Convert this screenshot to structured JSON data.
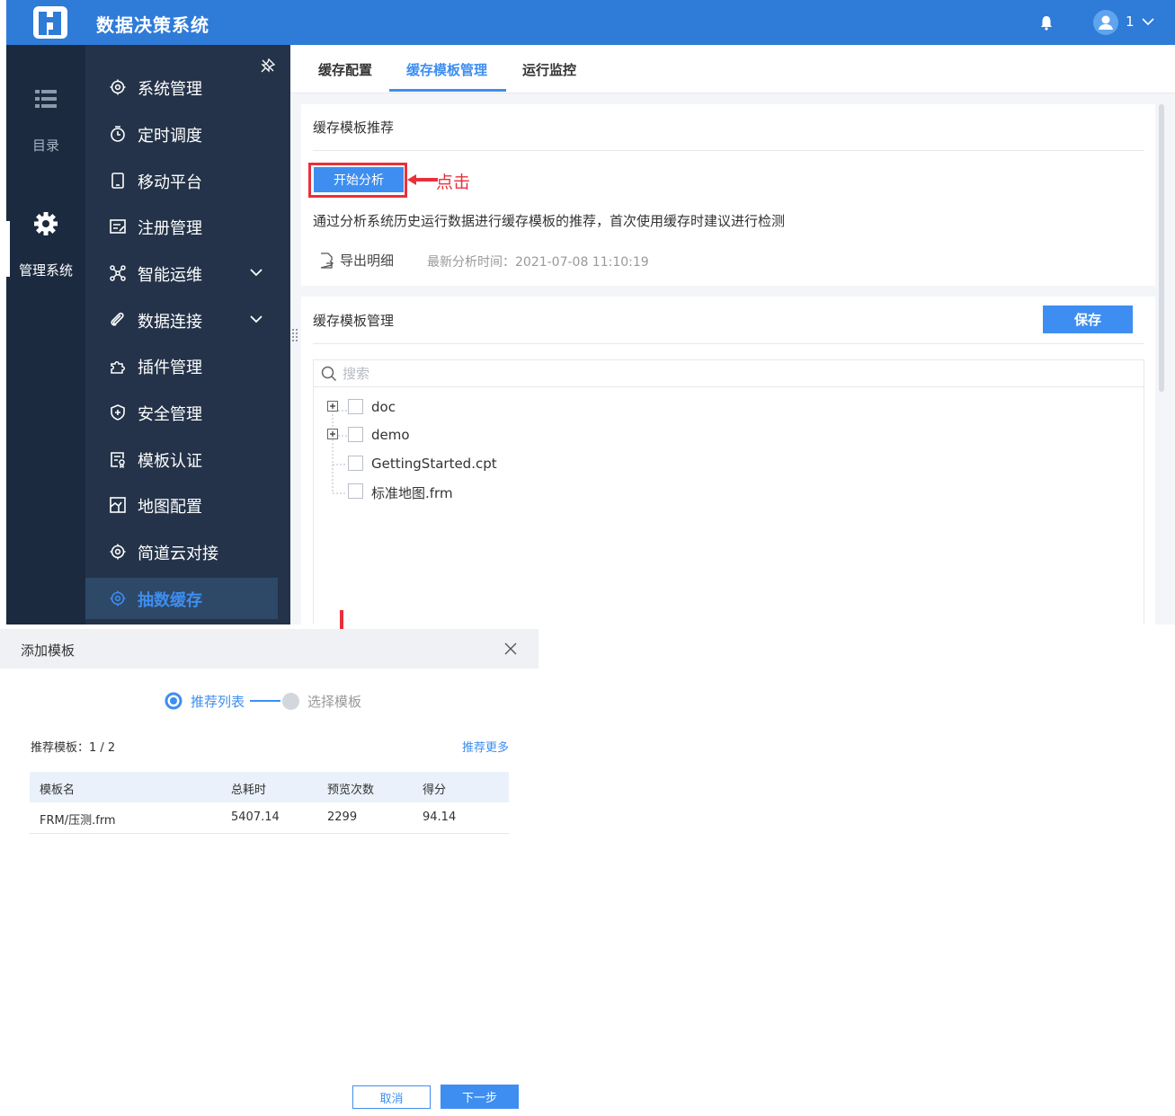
{
  "header": {
    "app_title": "数据决策系统",
    "user_label": "1",
    "brand_color": "#2f7bd8"
  },
  "rail": {
    "catalog_label": "目录",
    "management_label": "管理系统"
  },
  "menu": {
    "items": [
      {
        "label": "系统管理",
        "icon": "gear-icon"
      },
      {
        "label": "定时调度",
        "icon": "timer-icon"
      },
      {
        "label": "移动平台",
        "icon": "mobile-icon"
      },
      {
        "label": "注册管理",
        "icon": "register-icon"
      },
      {
        "label": "智能运维",
        "icon": "network-icon"
      },
      {
        "label": "数据连接",
        "icon": "link-icon"
      },
      {
        "label": "插件管理",
        "icon": "puzzle-icon"
      },
      {
        "label": "安全管理",
        "icon": "shield-icon"
      },
      {
        "label": "模板认证",
        "icon": "certificate-icon"
      },
      {
        "label": "地图配置",
        "icon": "map-icon"
      },
      {
        "label": "简道云对接",
        "icon": "gear-icon"
      },
      {
        "label": "抽数缓存",
        "icon": "gear-icon"
      }
    ],
    "active_color": "#3d8ef0"
  },
  "tabs": [
    {
      "label": "缓存配置"
    },
    {
      "label": "缓存模板管理"
    },
    {
      "label": "运行监控"
    }
  ],
  "recommend": {
    "title": "缓存模板推荐",
    "analyze_button": "开始分析",
    "click_annotation": "点击",
    "description": "通过分析系统历史运行数据进行缓存模板的推荐，首次使用缓存时建议进行检测",
    "export_label": "导出明细",
    "last_analysis": "最新分析时间：2021-07-08 11:10:19"
  },
  "template_mgmt": {
    "title": "缓存模板管理",
    "save_button": "保存",
    "search_placeholder": "搜索",
    "tree": [
      {
        "label": "doc"
      },
      {
        "label": "demo"
      },
      {
        "label": "GettingStarted.cpt"
      },
      {
        "label": "标准地图.frm"
      }
    ]
  },
  "dialog": {
    "title": "添加模板",
    "step1": "推荐列表",
    "step2": "选择模板",
    "rec_count": "推荐模板：1 / 2",
    "rec_more": "推荐更多",
    "columns": [
      "模板名",
      "总耗时",
      "预览次数",
      "得分"
    ],
    "rows": [
      [
        "FRM/压测.frm",
        "5407.14",
        "2299",
        "94.14"
      ]
    ],
    "cancel_button": "取消",
    "next_button": "下一步"
  }
}
